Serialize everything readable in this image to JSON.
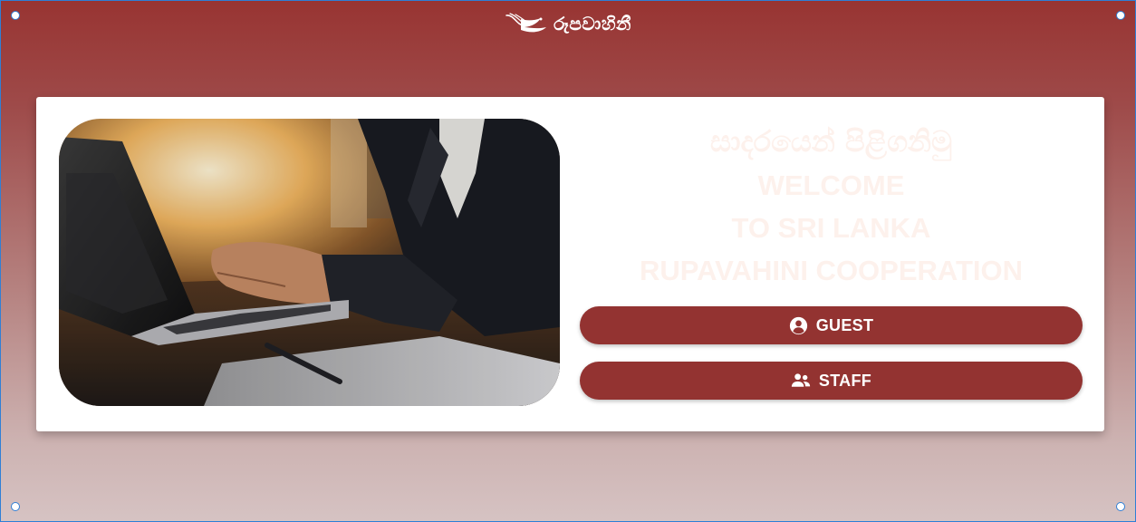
{
  "header": {
    "logo_text": "රූපවාහිනී",
    "logo_icon": "bird-icon"
  },
  "welcome": {
    "sinhala": "සාදරයෙන් පිළිගනිමු",
    "line1": "WELCOME",
    "line2": "TO SRI LANKA",
    "line3": "RUPAVAHINI COOPERATION"
  },
  "buttons": {
    "guest_label": "GUEST",
    "guest_icon": "account-circle-icon",
    "staff_label": "STAFF",
    "staff_icon": "people-icon"
  },
  "colors": {
    "brand": "#933331",
    "background_top": "#983432",
    "background_bottom": "#d6c3c3",
    "card": "#ffffff",
    "welcome_text": "#fdf1ec"
  }
}
